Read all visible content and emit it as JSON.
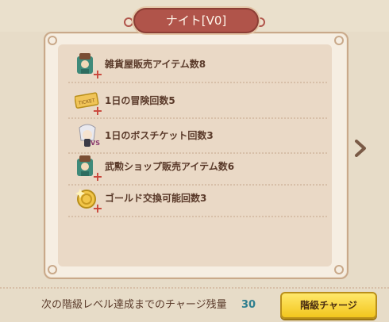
{
  "header": {
    "title": "ナイト[V0]"
  },
  "benefits": [
    {
      "label": "雑貨屋販売アイテム数8",
      "icon": "shop-npc-icon"
    },
    {
      "label": "1日の冒険回数5",
      "icon": "ticket-icon",
      "icon_text": "TICKET"
    },
    {
      "label": "1日のボスチケット回数3",
      "icon": "boss-vs-icon",
      "icon_text": "VS"
    },
    {
      "label": "武勲ショップ販売アイテム数6",
      "icon": "shop-npc-icon"
    },
    {
      "label": "ゴールド交換可能回数3",
      "icon": "gold-coin-icon"
    }
  ],
  "footer": {
    "charge_label": "次の階級レベル達成までのチャージ残量",
    "charge_value": "30",
    "charge_button": "階級チャージ"
  },
  "colors": {
    "title_bg": "#b0544a",
    "text": "#5a3a2a",
    "value": "#2f7f8f",
    "button": "#f2c61e"
  }
}
